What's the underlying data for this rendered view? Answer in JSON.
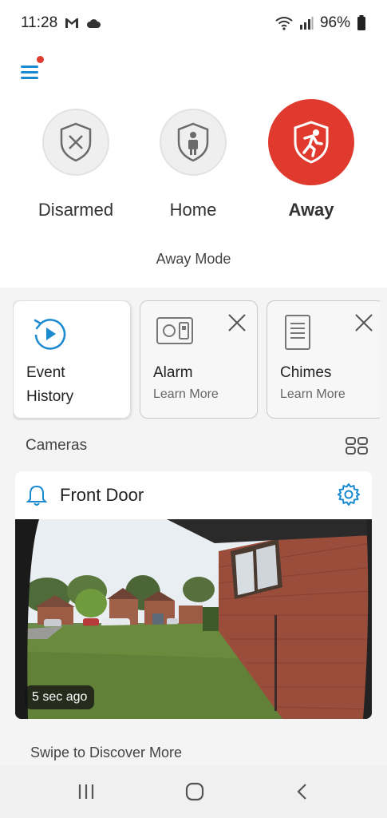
{
  "status_bar": {
    "time": "11:28",
    "battery": "96%"
  },
  "modes": [
    {
      "label": "Disarmed",
      "icon": "shield-x-icon"
    },
    {
      "label": "Home",
      "icon": "shield-person-icon"
    },
    {
      "label": "Away",
      "icon": "shield-running-icon"
    }
  ],
  "active_mode": "Away",
  "mode_caption": "Away Mode",
  "cards": [
    {
      "title_line1": "Event",
      "title_line2": "History",
      "icon": "history-play-icon"
    },
    {
      "title": "Alarm",
      "sub": "Learn More",
      "icon": "alarm-device-icon"
    },
    {
      "title": "Chimes",
      "sub": "Learn More",
      "icon": "chime-device-icon"
    }
  ],
  "cameras": {
    "header": "Cameras",
    "items": [
      {
        "name": "Front Door",
        "last_update": "5 sec ago"
      }
    ]
  },
  "swipe_hint": "Swipe to Discover More",
  "colors": {
    "accent": "#1a8ad1",
    "away_red": "#e03a2f"
  }
}
